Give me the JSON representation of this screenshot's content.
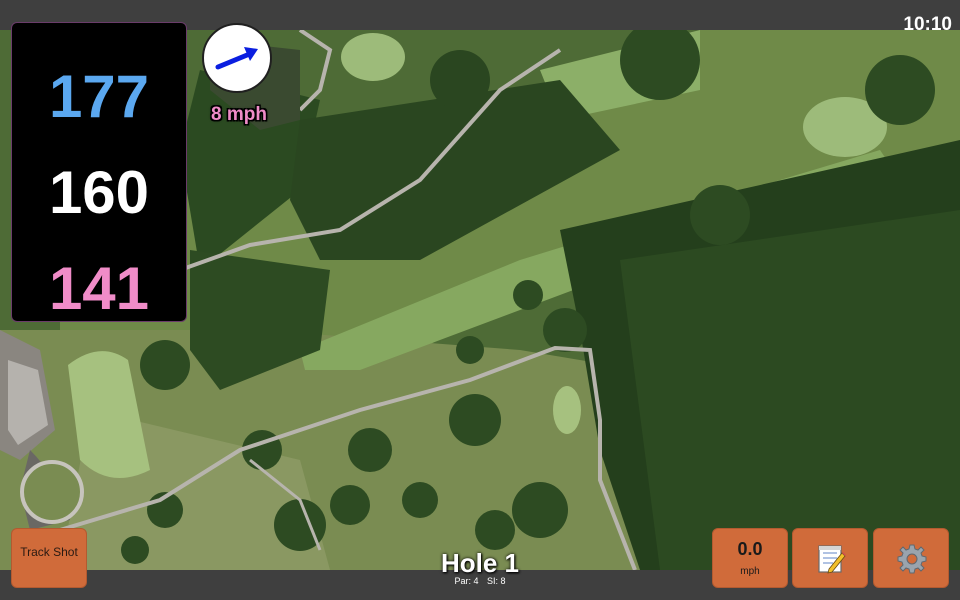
{
  "status": {
    "time": "10:10"
  },
  "distances": {
    "back": "177",
    "middle": "160",
    "front": "141",
    "colors": {
      "back": "#5ba8f0",
      "middle": "#ffffff",
      "front": "#f08cc8"
    }
  },
  "wind": {
    "speed_label": "8 mph",
    "arrow_color": "#0a1ee0",
    "label_color": "#f08cc8"
  },
  "hole": {
    "title": "Hole 1",
    "par_label": "Par: 4",
    "si_label": "SI: 8"
  },
  "buttons": {
    "track_shot": "Track Shot",
    "speed_value": "0.0",
    "speed_unit": "mph",
    "notes_icon": "notepad-icon",
    "settings_icon": "gear-icon"
  },
  "map": {
    "type": "satellite-golf-course"
  }
}
